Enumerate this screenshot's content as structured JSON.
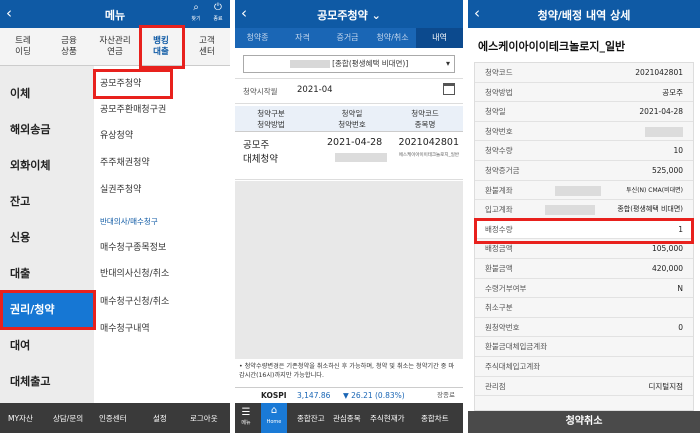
{
  "p1": {
    "title": "메뉴",
    "top_icons": [
      {
        "glyph": "⌕",
        "label": "찾기"
      },
      {
        "glyph": "⏻",
        "label": "종료"
      }
    ],
    "tabs": [
      {
        "l1": "트레",
        "l2": "이딩"
      },
      {
        "l1": "금융",
        "l2": "상품"
      },
      {
        "l1": "자산관리",
        "l2": "연금"
      },
      {
        "l1": "뱅킹",
        "l2": "대출"
      },
      {
        "l1": "고객",
        "l2": "센터"
      }
    ],
    "left_menu": [
      "이체",
      "해외송금",
      "외화이체",
      "잔고",
      "신용",
      "대출",
      "권리/청약",
      "대여",
      "대체출고"
    ],
    "sub_items": [
      "공모주청약",
      "공모주환매청구권",
      "유상청약",
      "주주채권청약",
      "실권주청약"
    ],
    "sub_header": "반대의사/매수청구",
    "sub_items2": [
      "매수청구종목정보",
      "반대의사신청/취소",
      "매수청구신청/취소",
      "매수청구내역"
    ],
    "bottom": [
      "MY자산",
      "상담/문의",
      "인증센터",
      "설정",
      "로그아웃"
    ]
  },
  "p2": {
    "title": "공모주청약",
    "title_arrow": "⌄",
    "tabs": [
      "청약종",
      "자격",
      "증거금",
      "청약/취소",
      "내역"
    ],
    "select": "[종합(평생혜택 비대면)]",
    "date_label": "청약시작월",
    "date_value": "2021-04",
    "headers": [
      {
        "l1": "청약구분",
        "l2": "청약방법"
      },
      {
        "l1": "청약일",
        "l2": "청약번호"
      },
      {
        "l1": "청약코드",
        "l2": "종목명"
      }
    ],
    "row": {
      "c1": "공모주",
      "c1b": "대체청약",
      "c2": "2021-04-28",
      "c3": "2021042801",
      "c3b": "에스케이아이이테크놀로지_일반"
    },
    "note": "• 청약수량변경은 기존청약을 취소하신 후 가능하며, 청약 및 취소는 청약기간 중 마감시간(16시)까지만 가능합니다.",
    "kospi": {
      "label": "KOSPI",
      "value": "3,147.86",
      "change": "▼ 26.21 (0.83%)",
      "status": "장종료"
    },
    "bottom_nav": [
      "메뉴",
      "Home",
      "종합잔고",
      "관심종목",
      "주식현재가",
      "종합차트"
    ]
  },
  "p3": {
    "title": "청약/배정 내역 상세",
    "stock_name": "에스케이아이이테크놀로지_일반",
    "rows": [
      {
        "k": "청약코드",
        "v": "2021042801"
      },
      {
        "k": "청약방법",
        "v": "공모주"
      },
      {
        "k": "청약일",
        "v": "2021-04-28"
      },
      {
        "k": "청약번호",
        "v": ""
      },
      {
        "k": "청약수량",
        "v": "10"
      },
      {
        "k": "청약증거금",
        "v": "525,000"
      },
      {
        "k": "환불계좌",
        "v": "투신(N) CMA(비대면)"
      },
      {
        "k": "입고계좌",
        "v": "종합(평생혜택 비대면)"
      },
      {
        "k": "배정수량",
        "v": "1"
      },
      {
        "k": "배정금액",
        "v": "105,000"
      },
      {
        "k": "환불금액",
        "v": "420,000"
      },
      {
        "k": "수령거부여부",
        "v": "N"
      },
      {
        "k": "취소구분",
        "v": ""
      },
      {
        "k": "원청약번호",
        "v": "0"
      },
      {
        "k": "환불금대체입금계좌",
        "v": ""
      },
      {
        "k": "주식대체입고계좌",
        "v": ""
      },
      {
        "k": "관리점",
        "v": "디지털지점"
      }
    ],
    "button": "청약취소"
  }
}
